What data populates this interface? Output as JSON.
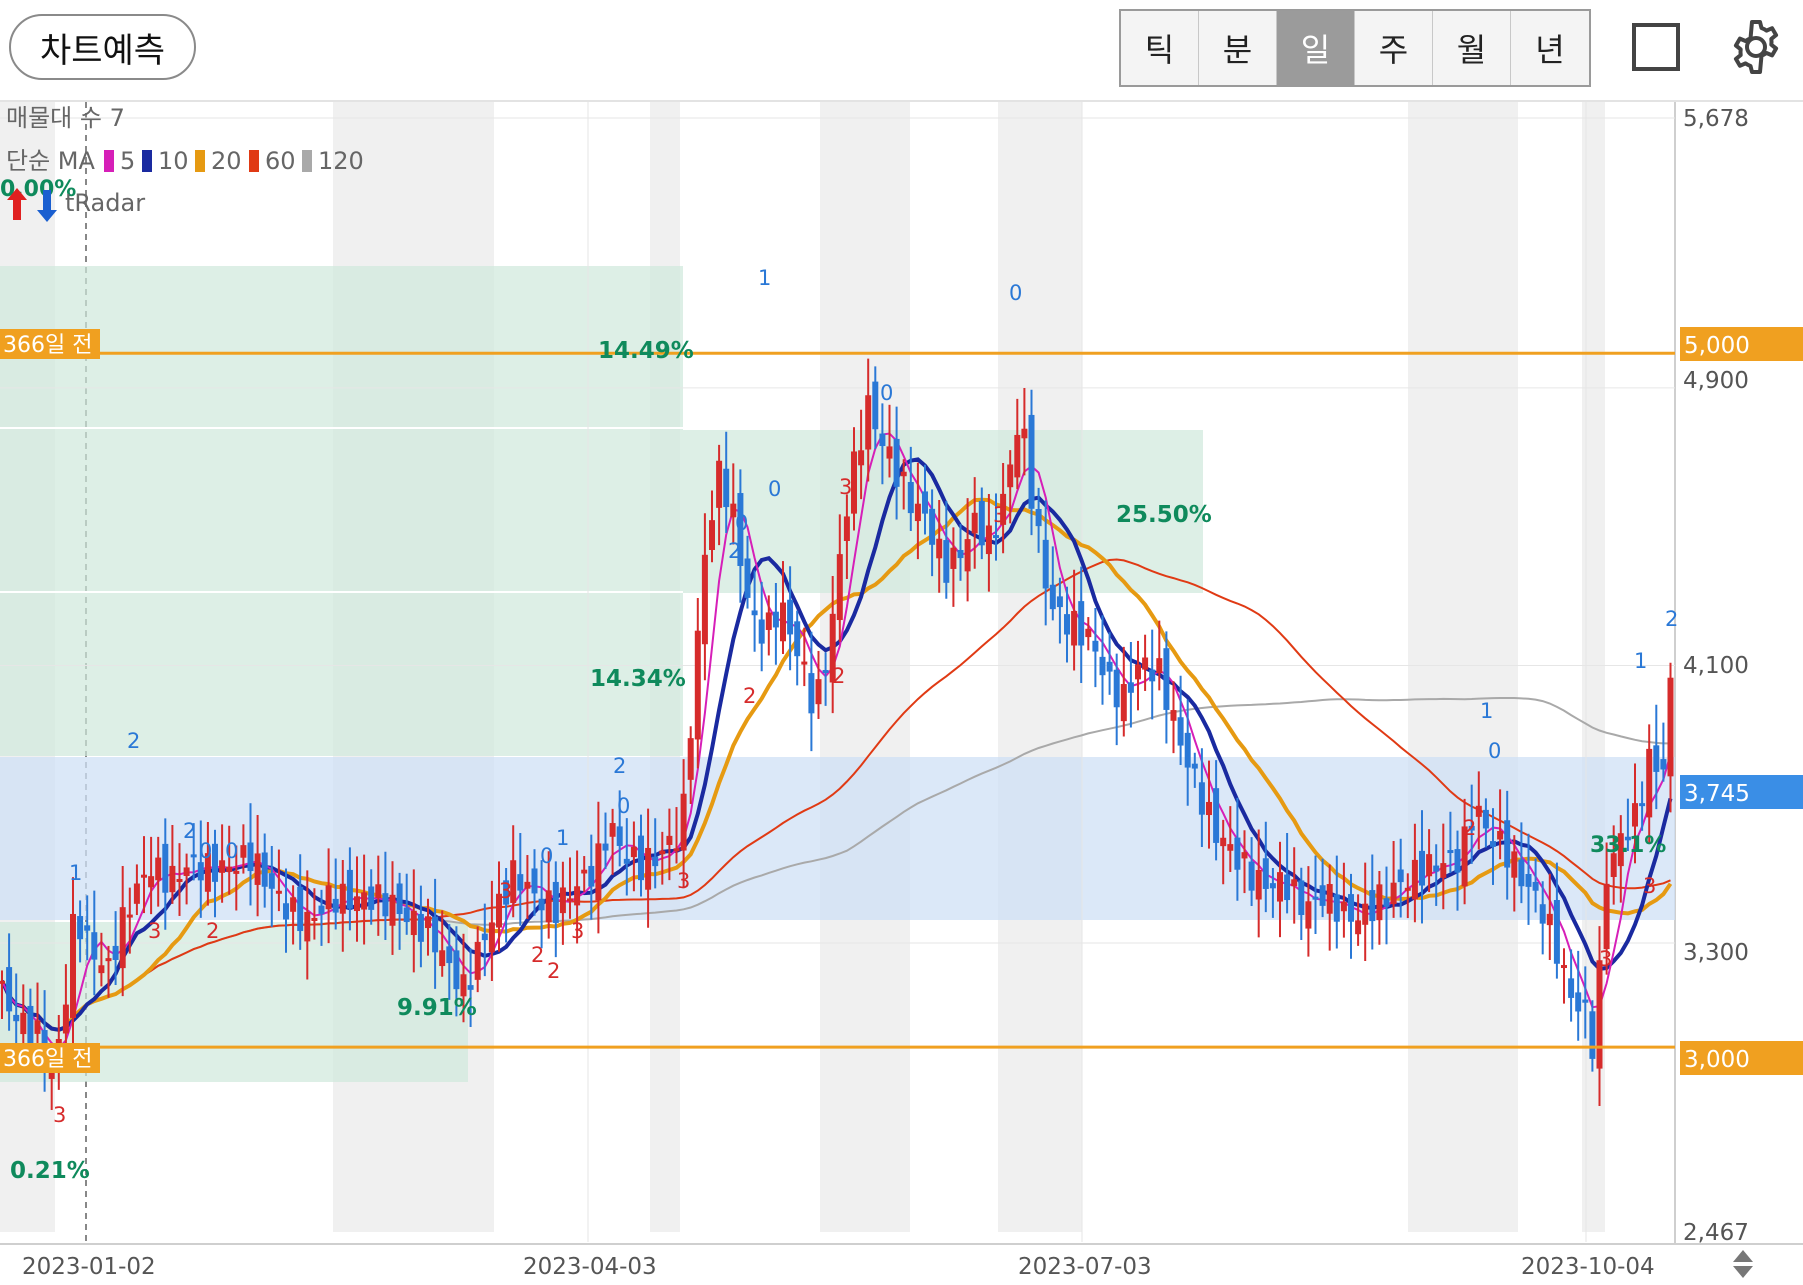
{
  "toolbar": {
    "predict_label": "차트예측",
    "periods": [
      {
        "label": "틱",
        "active": false
      },
      {
        "label": "분",
        "active": false
      },
      {
        "label": "일",
        "active": true
      },
      {
        "label": "주",
        "active": false
      },
      {
        "label": "월",
        "active": false
      },
      {
        "label": "년",
        "active": false
      }
    ],
    "icons": {
      "layout": "square-icon",
      "settings": "gear-icon"
    }
  },
  "legend": {
    "volume_profile": "매물대 수 7",
    "ma_title": "단순 MA",
    "ma_periods": [
      {
        "label": "5",
        "color": "#d61fb8"
      },
      {
        "label": "10",
        "color": "#1a2aa0"
      },
      {
        "label": "20",
        "color": "#e69a12"
      },
      {
        "label": "60",
        "color": "#e03a14"
      },
      {
        "label": "120",
        "color": "#a9a9a9"
      }
    ],
    "radar_label": "tRadar",
    "radar_pct": "0.00%"
  },
  "colors": {
    "up": "#d62b2b",
    "down": "#2a78d6",
    "ref_line": "#f0a020",
    "current_price_tag": "#3a8ee6",
    "pct_text": "#0f8a5c"
  },
  "chart_data": {
    "type": "candlestick",
    "price_range": [
      2467,
      5678
    ],
    "y_ticks": [
      "5,678",
      "4,900",
      "4,100",
      "3,300",
      "2,467"
    ],
    "x_labels": [
      "2023-01-02",
      "2023-04-03",
      "2023-07-03",
      "2023-10-04"
    ],
    "reference_lines": [
      {
        "label": "366일 전",
        "value": 5000,
        "value_label": "5,000"
      },
      {
        "label": "366일 전",
        "value": 3000,
        "value_label": "3,000"
      }
    ],
    "current_price": {
      "value": 3745,
      "label": "3,745"
    },
    "percent_labels": [
      "14.49%",
      "14.34%",
      "9.91%",
      "25.50%",
      "0.21%",
      "33.1%"
    ],
    "signal_marks": [
      "0",
      "1",
      "2",
      "3"
    ]
  }
}
